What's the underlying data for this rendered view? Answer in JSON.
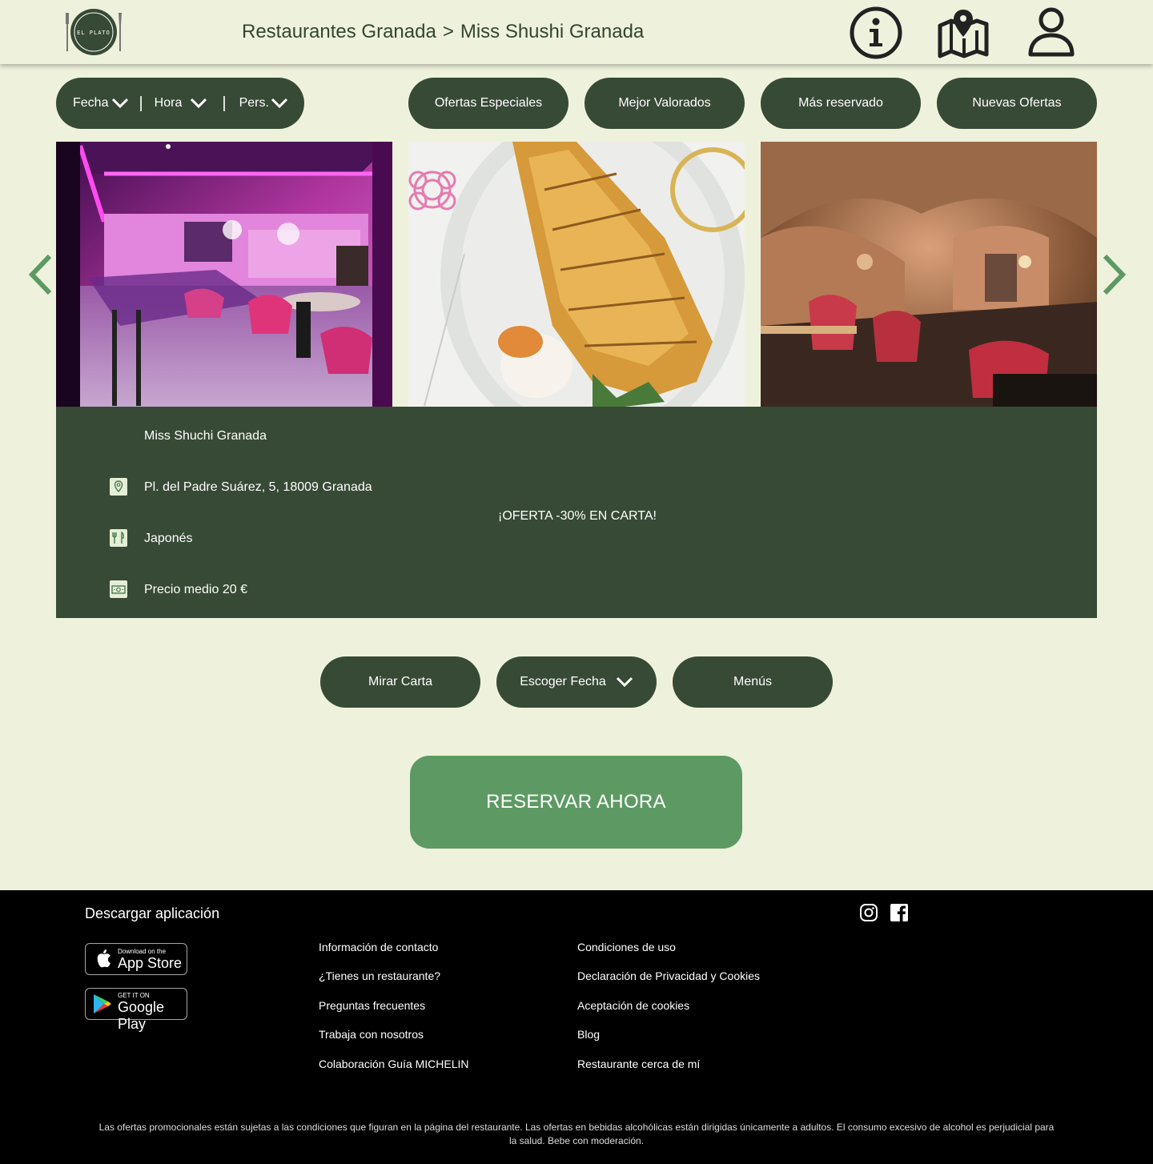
{
  "header": {
    "logo_text": "EL PLATO",
    "breadcrumb": {
      "parent": "Restaurantes Granada",
      "separator": ">",
      "current": "Miss Shushi Granada"
    },
    "icons": [
      "info-icon",
      "map-icon",
      "user-icon"
    ]
  },
  "filters": {
    "date_label": "Fecha",
    "time_label": "Hora",
    "people_label": "Pers.",
    "separator": "|"
  },
  "tabs": [
    {
      "label": "Ofertas Especiales"
    },
    {
      "label": "Mejor Valorados"
    },
    {
      "label": "Más reservado"
    },
    {
      "label": "Nuevas Ofertas"
    }
  ],
  "restaurant": {
    "name": "Miss Shuchi Granada",
    "address": "Pl. del Padre Suárez, 5, 18009 Granada",
    "cuisine": "Japonés",
    "price": "Precio medio 20 €",
    "offer": "¡OFERTA -30% EN CARTA!"
  },
  "actions": {
    "menu_card": "Mirar Carta",
    "choose_date": "Escoger Fecha",
    "menus": "Menús",
    "reserve": "RESERVAR AHORA"
  },
  "colors": {
    "background": "#eef2dc",
    "dark_green": "#374a35",
    "accent_green": "#5d9a63",
    "footer": "#000000"
  },
  "footer": {
    "app_title": "Descargar aplicación",
    "app_store": {
      "small": "Download on the",
      "big": "App Store"
    },
    "google_play": {
      "small": "GET IT ON",
      "big": "Google Play"
    },
    "links_col1": [
      "Información de contacto",
      "¿Tienes un restaurante?",
      "Preguntas frecuentes",
      "Trabaja con nosotros",
      "Colaboración Guía MICHELIN"
    ],
    "links_col2": [
      "Condiciones de uso",
      "Declaración de Privacidad y Cookies",
      "Aceptación de cookies",
      "Blog",
      "Restaurante cerca de mí"
    ],
    "disclaimer": "Las ofertas promocionales están sujetas a las condiciones que figuran en la página del restaurante. Las ofertas en bebidas alcohólicas están dirigidas únicamente a adultos. El consumo excesivo de alcohol es perjudicial para la salud. Bebe con moderación."
  }
}
